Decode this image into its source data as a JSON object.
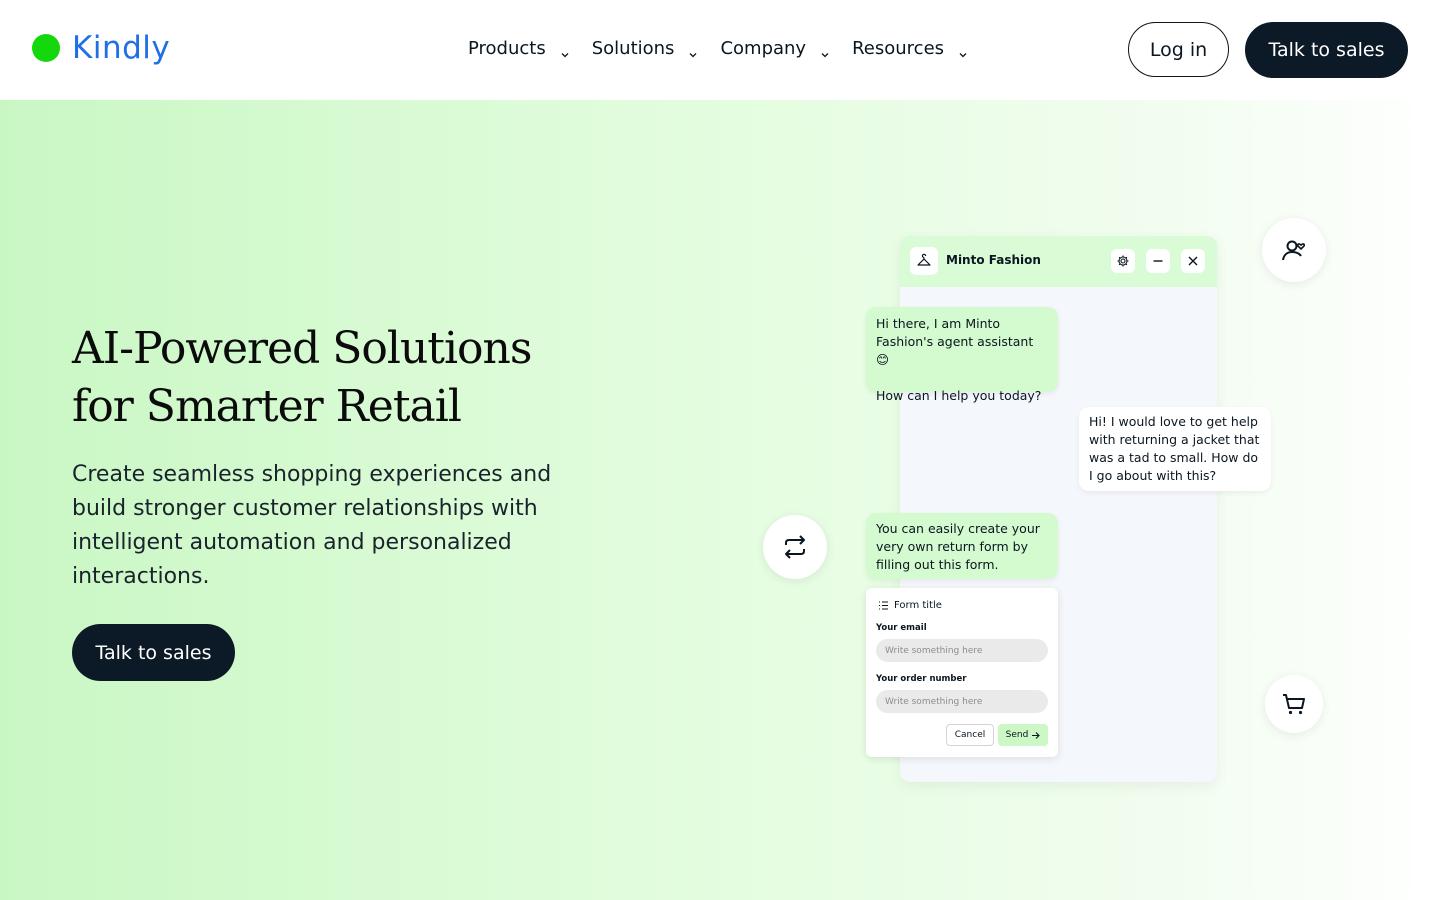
{
  "brand": {
    "name": "Kindly",
    "dot_color": "#14d80c",
    "text_color": "#1f6fe5"
  },
  "nav": {
    "items": [
      {
        "label": "Products"
      },
      {
        "label": "Solutions"
      },
      {
        "label": "Company"
      },
      {
        "label": "Resources"
      }
    ],
    "login_label": "Log in",
    "sales_label": "Talk to sales"
  },
  "hero": {
    "title_line1": "AI-Powered Solutions",
    "title_line2": "for Smarter Retail",
    "subtitle": "Create seamless shopping experiences and build stronger customer relationships with intelligent automation and personalized interactions.",
    "cta_label": "Talk to sales"
  },
  "chat": {
    "header_name": "Minto Fashion",
    "icons": [
      "hanger-icon",
      "gear-icon",
      "minimize-icon",
      "close-icon"
    ],
    "msg1_line1": "Hi there, I am Minto Fashion's agent assistant 😊",
    "msg1_line2": "How can I help you today?",
    "msg2": "Hi! I would love to get help with returning a jacket that was a tad to small. How do I go about with this?",
    "msg3": "You can easily create your very own return form by filling out this form.",
    "form": {
      "title": "Form title",
      "email_label": "Your email",
      "email_placeholder": "Write something here",
      "order_label": "Your order number",
      "order_placeholder": "Write something here",
      "cancel_label": "Cancel",
      "send_label": "Send"
    }
  },
  "floating_icons": [
    "person-heart-icon",
    "repeat-icon",
    "cart-icon"
  ],
  "colors": {
    "accent_dark": "#0b1a26",
    "bubble_green": "#d4fbcf",
    "hero_bg_start": "#c9f7c4"
  }
}
